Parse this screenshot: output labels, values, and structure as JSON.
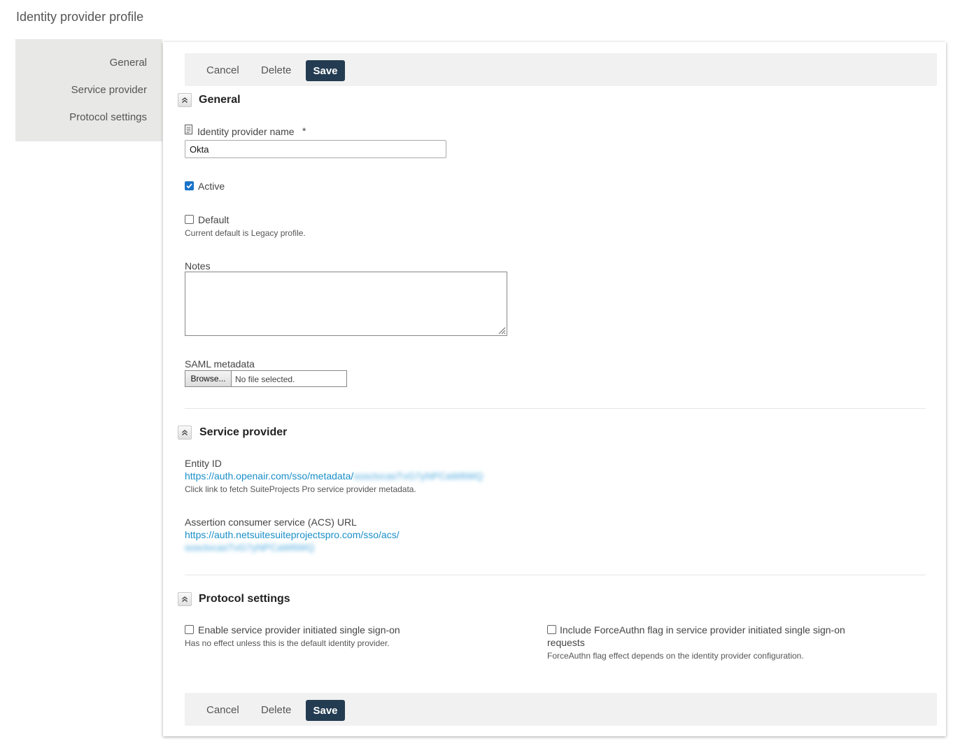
{
  "page": {
    "title": "Identity provider profile"
  },
  "sidebar": {
    "items": [
      {
        "label": "General"
      },
      {
        "label": "Service provider"
      },
      {
        "label": "Protocol settings"
      }
    ]
  },
  "toolbar": {
    "cancel_label": "Cancel",
    "delete_label": "Delete",
    "save_label": "Save"
  },
  "general": {
    "title": "General",
    "name_label": "Identity provider name",
    "required_marker": "*",
    "name_value": "Okta",
    "active_label": "Active",
    "active_checked": true,
    "default_label": "Default",
    "default_checked": false,
    "default_help": "Current default is Legacy profile.",
    "notes_label": "Notes",
    "saml_label": "SAML metadata",
    "browse_label": "Browse...",
    "file_status": "No file selected."
  },
  "service_provider": {
    "title": "Service provider",
    "entity_id_label": "Entity ID",
    "entity_id_url": "https://auth.openair.com/sso/metadata/",
    "entity_id_hidden": "sosctvcasTvG7yNPCaW6WQ",
    "entity_id_help": "Click link to fetch SuiteProjects Pro service provider metadata.",
    "acs_label": "Assertion consumer service (ACS) URL",
    "acs_url": "https://auth.netsuitesuiteprojectspro.com/sso/acs/",
    "acs_hidden": "sosctvcasTvG7yNPCaW6WQ"
  },
  "protocol": {
    "title": "Protocol settings",
    "sp_initiated_label": "Enable service provider initiated single sign-on",
    "sp_initiated_checked": false,
    "sp_initiated_help": "Has no effect unless this is the default identity provider.",
    "force_authn_label_line1": "Include ForceAuthn flag in service provider initiated single sign-on",
    "force_authn_label_line2": "requests",
    "force_authn_checked": false,
    "force_authn_help": "ForceAuthn flag effect depends on the identity provider configuration."
  },
  "colors": {
    "save_button": "#243c52",
    "link": "#1a8fc9",
    "checkbox_checked": "#1a73c9",
    "sidebar_bg": "#e8e8e6"
  },
  "icons": {
    "collapse": "double-chevron-up-icon",
    "field_info": "document-icon",
    "check": "checkmark-icon"
  }
}
